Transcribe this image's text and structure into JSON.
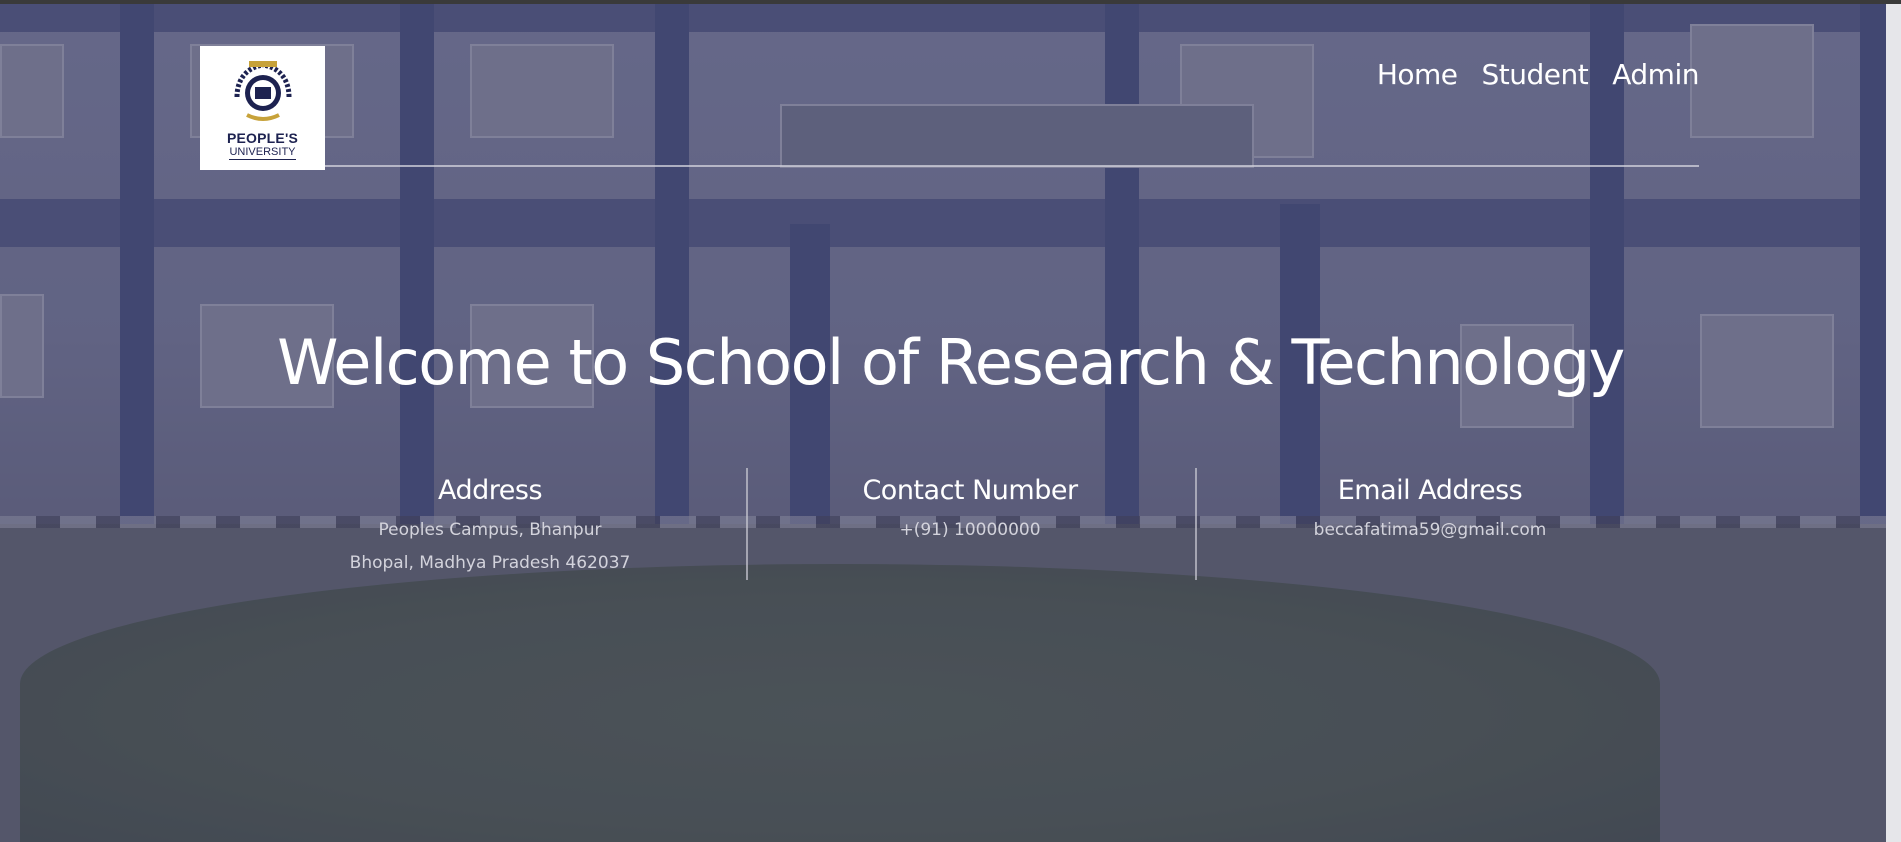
{
  "logo": {
    "name": "PEOPLE'S",
    "sub": "UNIVERSITY"
  },
  "nav": {
    "items": [
      {
        "label": "Home"
      },
      {
        "label": "Student"
      },
      {
        "label": "Admin"
      }
    ]
  },
  "hero": {
    "title": "Welcome to School of Research & Technology"
  },
  "info": {
    "address": {
      "heading": "Address",
      "line1": "Peoples Campus, Bhanpur",
      "line2": "Bhopal, Madhya Pradesh 462037"
    },
    "contact": {
      "heading": "Contact Number",
      "value": "+(91) 10000000"
    },
    "email": {
      "heading": "Email Address",
      "value": "beccafatima59@gmail.com"
    }
  },
  "colors": {
    "overlay": "#30325c",
    "text": "#ffffff",
    "muted_text": "#d3d3dc",
    "logo_navy": "#1d2250"
  },
  "icons": {
    "logo_emblem": "university-crest-icon"
  }
}
